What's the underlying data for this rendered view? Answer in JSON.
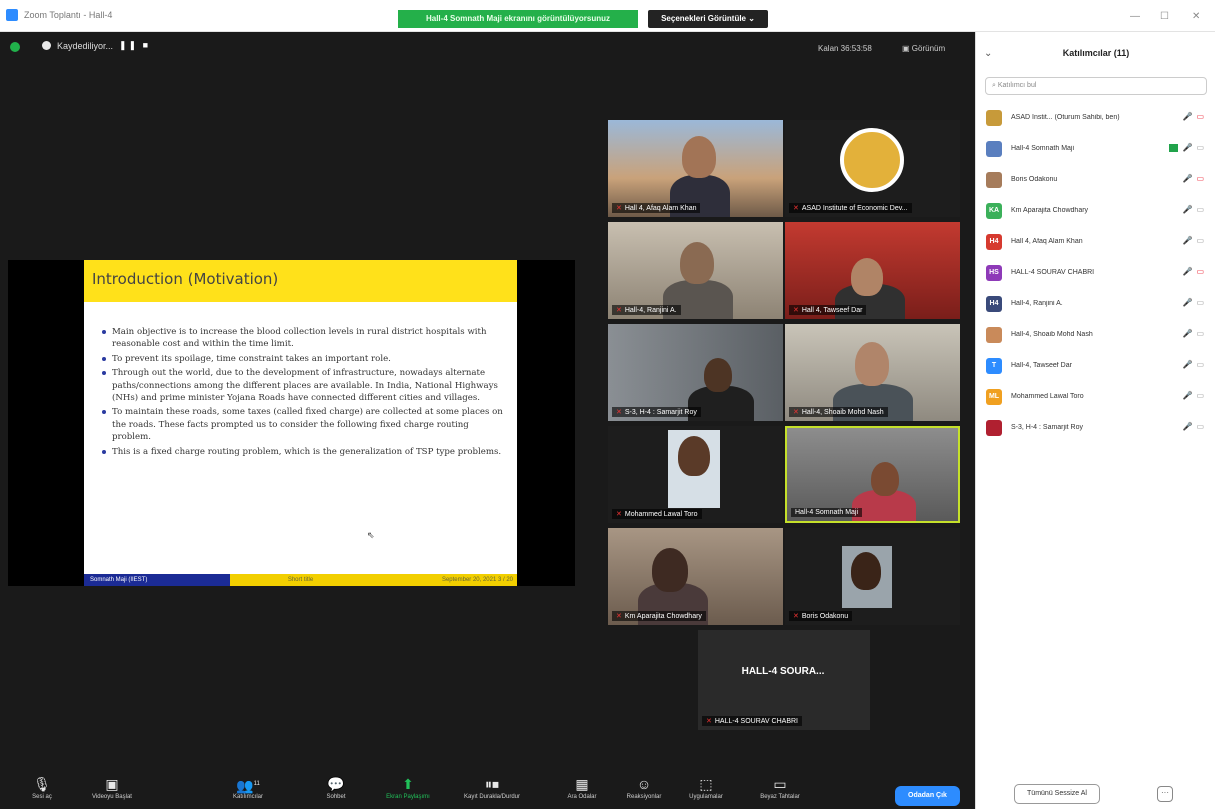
{
  "window": {
    "title": "Zoom Toplantı - Hall-4",
    "share_banner": "Hall-4 Somnath Maji ekranını görüntülüyorsunuz",
    "view_options": "Seçenekleri Görüntüle ⌄",
    "minimize": "—",
    "maximize": "☐",
    "close": "✕"
  },
  "top": {
    "recording": "Kaydediliyor...",
    "rec_controls": "❚❚ ■",
    "timer": "Kalan 36:53:58",
    "view": "Görünüm"
  },
  "slide": {
    "title": "Introduction (Motivation)",
    "bullets": [
      "Main objective is to increase the blood collection levels in rural district hospitals with reasonable cost and within the time limit.",
      "To prevent its spoilage, time constraint takes an important role.",
      "Through out the world, due to the development of infrastructure, nowadays alternate paths/connections among the different places are available. In India, National Highways (NHs) and prime minister Yojana Roads have connected different cities and villages.",
      "To maintain these roads, some taxes (called fixed charge) are collected at some places on the roads. These facts prompted us to consider the following fixed charge routing problem.",
      "This is a fixed charge routing problem, which is the generalization of TSP type problems."
    ],
    "footer_left": "Somnath Maji (IIEST)",
    "footer_mid": "Short title",
    "footer_right": "September 20, 2021  3 / 20"
  },
  "tiles": [
    "Hall 4, Afaq Alam Khan",
    "ASAD Institute of Economic Dev...",
    "Hall-4, Ranjini A.",
    "Hall 4, Tawseef Dar",
    "S-3, H-4 : Samarjit Roy",
    "Hall-4, Shoaib Mohd Nash",
    "Mohammed Lawal Toro",
    "Hall-4 Somnath Maji",
    "Km Aparajita Chowdhary",
    "Boris Odakonu",
    "HALL-4 SOURAV CHABRI"
  ],
  "big_tile_label": "HALL-4 SOURA...",
  "toolbar": {
    "audio": "Sesi aç",
    "video": "Videoyu Başlat",
    "participants": "Katılımcılar",
    "participants_count": "11",
    "chat": "Sohbet",
    "share": "Ekran Paylaşımı",
    "polls": "Kayıt Durakla/Durdur",
    "breakout": "Ara Odalar",
    "reactions": "Reaksiyonlar",
    "apps": "Uygulamalar",
    "whiteboard": "Beyaz Tahtalar",
    "leave": "Odadan Çık"
  },
  "panel": {
    "title": "Katılımcılar (11)",
    "search_placeholder": "Katılımcı bul",
    "participants": [
      {
        "initials": "",
        "name": "ASAD Instit... (Oturum Sahibi, ben)",
        "color": "#c79a3a"
      },
      {
        "initials": "",
        "name": "Hall-4 Somnath Maji",
        "color": "#5a7fbf"
      },
      {
        "initials": "",
        "name": "Boris Odakonu",
        "color": "#a67c5b"
      },
      {
        "initials": "KA",
        "name": "Km Aparajita Chowdhary",
        "color": "#3bb05a"
      },
      {
        "initials": "H4",
        "name": "Hall 4, Afaq Alam Khan",
        "color": "#d63a2f"
      },
      {
        "initials": "HS",
        "name": "HALL-4 SOURAV CHABRI",
        "color": "#8e3ab8"
      },
      {
        "initials": "H4",
        "name": "Hall-4, Ranjini A.",
        "color": "#3a4a7a"
      },
      {
        "initials": "",
        "name": "Hall-4, Shoaib Mohd Nash",
        "color": "#c98a5a"
      },
      {
        "initials": "T",
        "name": "Hall-4, Tawseef Dar",
        "color": "#2d8cff"
      },
      {
        "initials": "ML",
        "name": "Mohammed Lawal Toro",
        "color": "#f0a020"
      },
      {
        "initials": "",
        "name": "S-3, H-4 : Samarjit Roy",
        "color": "#b02030"
      }
    ],
    "mute_all": "Tümünü Sessize Al",
    "more": "···"
  }
}
